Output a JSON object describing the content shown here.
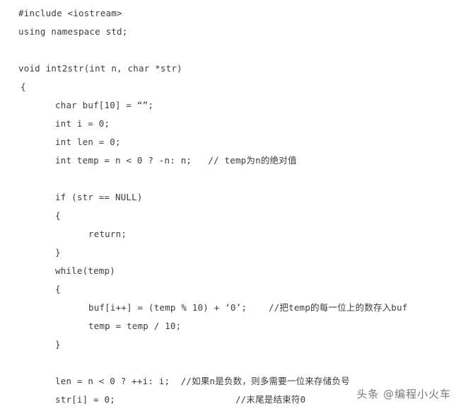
{
  "page": {
    "background_color": "#ffffff",
    "text_color": "#3c3c3c",
    "kind": "code-snippet-image"
  },
  "code": {
    "language": "C++",
    "lines": [
      {
        "indent": "i0",
        "src": "#include <iostream>",
        "comment": ""
      },
      {
        "indent": "i0",
        "src": "using namespace std;",
        "comment": ""
      },
      {
        "indent": "i0",
        "src": "",
        "comment": ""
      },
      {
        "indent": "i0",
        "src": "void int2str(int n, char *str)",
        "comment": ""
      },
      {
        "indent": "i1",
        "src": "{",
        "comment": ""
      },
      {
        "indent": "i2",
        "src": "char buf[10] = “”;",
        "comment": ""
      },
      {
        "indent": "i2",
        "src": "int i = 0;",
        "comment": ""
      },
      {
        "indent": "i2",
        "src": "int len = 0;",
        "comment": ""
      },
      {
        "indent": "i2",
        "src": "int temp = n < 0 ? -n: n;",
        "comment": "   // temp为n的绝对值"
      },
      {
        "indent": "i2",
        "src": "",
        "comment": ""
      },
      {
        "indent": "i2",
        "src": "if (str == NULL)",
        "comment": ""
      },
      {
        "indent": "i2",
        "src": "{",
        "comment": ""
      },
      {
        "indent": "i4",
        "src": "return;",
        "comment": ""
      },
      {
        "indent": "i2",
        "src": "}",
        "comment": ""
      },
      {
        "indent": "i2",
        "src": "while(temp)",
        "comment": ""
      },
      {
        "indent": "i2",
        "src": "{",
        "comment": ""
      },
      {
        "indent": "i4",
        "src": "buf[i++] = (temp % 10) + ‘0’;",
        "comment": "    //把temp的每一位上的数存入buf"
      },
      {
        "indent": "i4",
        "src": "temp = temp / 10;",
        "comment": ""
      },
      {
        "indent": "i2",
        "src": "}",
        "comment": ""
      },
      {
        "indent": "i2",
        "src": "",
        "comment": ""
      },
      {
        "indent": "i2",
        "src": "len = n < 0 ? ++i: i;",
        "comment": "  //如果n是负数，则多需要一位来存储负号"
      },
      {
        "indent": "i2",
        "src": "str[i] = 0;",
        "comment": "                      //末尾是结束符0"
      }
    ]
  },
  "watermark": {
    "text": "头条 @编程小火车"
  }
}
